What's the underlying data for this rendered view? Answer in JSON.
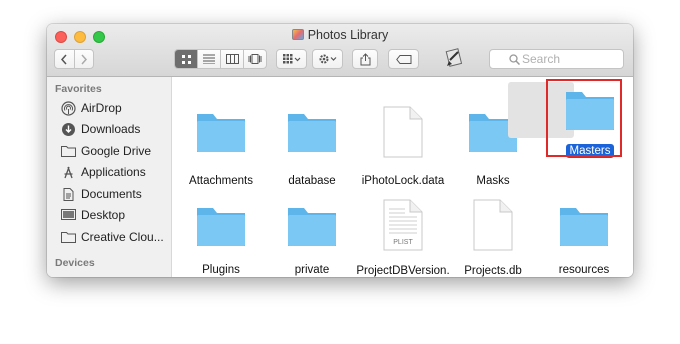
{
  "window": {
    "title": "Photos Library"
  },
  "search": {
    "placeholder": "Search"
  },
  "sidebar": {
    "favorites_heading": "Favorites",
    "devices_heading": "Devices",
    "items": [
      {
        "label": "AirDrop",
        "icon": "airdrop-icon"
      },
      {
        "label": "Downloads",
        "icon": "downloads-icon"
      },
      {
        "label": "Google Drive",
        "icon": "folder-icon"
      },
      {
        "label": "Applications",
        "icon": "applications-icon"
      },
      {
        "label": "Documents",
        "icon": "documents-icon"
      },
      {
        "label": "Desktop",
        "icon": "desktop-icon"
      },
      {
        "label": "Creative Clou...",
        "icon": "folder-icon"
      }
    ]
  },
  "files": [
    {
      "name": "Attachments",
      "type": "folder"
    },
    {
      "name": "database",
      "type": "folder"
    },
    {
      "name": "iPhotoLock.data",
      "type": "document"
    },
    {
      "name": "Masks",
      "type": "folder"
    },
    {
      "name": "Masters",
      "type": "folder",
      "selected": true
    },
    {
      "name": "Plugins",
      "type": "folder"
    },
    {
      "name": "private",
      "type": "folder"
    },
    {
      "name": "ProjectDBVersion.",
      "name_line2": "plist",
      "type": "plist",
      "badge": "PLIST"
    },
    {
      "name": "Projects.db",
      "type": "document"
    },
    {
      "name": "resources",
      "type": "folder"
    }
  ],
  "colors": {
    "folder": "#6ec3f4",
    "selection": "#1a63d8",
    "highlight_box": "#e02a2a"
  }
}
